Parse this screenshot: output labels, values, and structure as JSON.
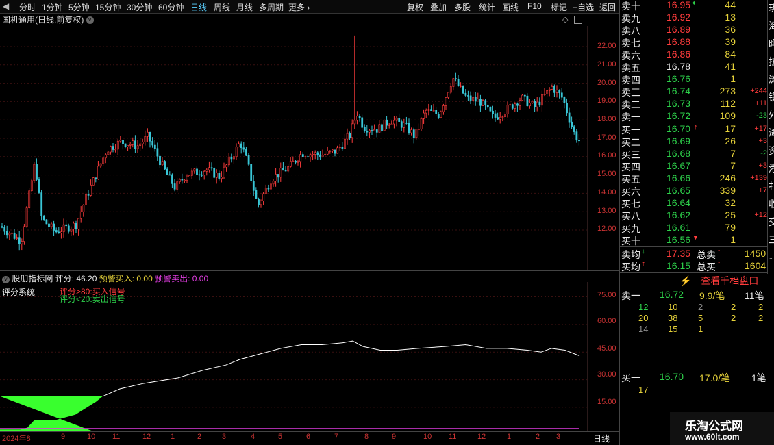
{
  "toolbar": {
    "periods": [
      "分时",
      "1分钟",
      "5分钟",
      "15分钟",
      "30分钟",
      "60分钟",
      "日线",
      "周线",
      "月线",
      "多周期",
      "更多"
    ],
    "active_period": "日线",
    "right_buttons": [
      "复权",
      "叠加",
      "多股",
      "统计",
      "画线",
      "F10",
      "标记",
      "+自选",
      "返回"
    ]
  },
  "chart_title": "国机通用(日线,前复权)",
  "price_axis": [
    "22.00",
    "21.00",
    "20.00",
    "19.00",
    "18.00",
    "17.00",
    "16.00",
    "15.00",
    "14.00",
    "13.00",
    "12.00"
  ],
  "indicator": {
    "name": "股朋指标网",
    "score_label": "评分: 46.20",
    "buy_alert": "预警买入: 0.00",
    "sell_alert": "预警卖出: 0.00",
    "system_label": "评分系统",
    "note_buy": "评分>80:买入信号",
    "note_sell": "评分<20:卖出信号",
    "axis": [
      "75.00",
      "60.00",
      "45.00",
      "30.00",
      "15.00"
    ]
  },
  "x_axis_labels": [
    "2024年8",
    "9",
    "10",
    "11",
    "12",
    "1",
    "2",
    "3",
    "4",
    "5",
    "6",
    "7",
    "8",
    "9",
    "10",
    "11",
    "12",
    "1",
    "2",
    "3"
  ],
  "x_axis_period": "日线",
  "orderbook": {
    "asks": [
      {
        "label": "卖十",
        "price": "16.95",
        "vol": "44",
        "chg": ""
      },
      {
        "label": "卖九",
        "price": "16.92",
        "vol": "13",
        "chg": ""
      },
      {
        "label": "卖八",
        "price": "16.89",
        "vol": "36",
        "chg": ""
      },
      {
        "label": "卖七",
        "price": "16.88",
        "vol": "39",
        "chg": ""
      },
      {
        "label": "卖六",
        "price": "16.86",
        "vol": "84",
        "chg": ""
      },
      {
        "label": "卖五",
        "price": "16.78",
        "vol": "41",
        "chg": ""
      },
      {
        "label": "卖四",
        "price": "16.76",
        "vol": "1",
        "chg": ""
      },
      {
        "label": "卖三",
        "price": "16.74",
        "vol": "273",
        "chg": "+244"
      },
      {
        "label": "卖二",
        "price": "16.73",
        "vol": "112",
        "chg": "+11"
      },
      {
        "label": "卖一",
        "price": "16.72",
        "vol": "109",
        "chg": "-23"
      }
    ],
    "bids": [
      {
        "label": "买一",
        "price": "16.70",
        "vol": "17",
        "chg": "+17"
      },
      {
        "label": "买二",
        "price": "16.69",
        "vol": "26",
        "chg": "+3"
      },
      {
        "label": "买三",
        "price": "16.68",
        "vol": "7",
        "chg": "-2"
      },
      {
        "label": "买四",
        "price": "16.67",
        "vol": "7",
        "chg": "+3"
      },
      {
        "label": "买五",
        "price": "16.66",
        "vol": "246",
        "chg": "+139"
      },
      {
        "label": "买六",
        "price": "16.65",
        "vol": "339",
        "chg": "+7"
      },
      {
        "label": "买七",
        "price": "16.64",
        "vol": "32",
        "chg": ""
      },
      {
        "label": "买八",
        "price": "16.62",
        "vol": "25",
        "chg": "+12"
      },
      {
        "label": "买九",
        "price": "16.61",
        "vol": "79",
        "chg": ""
      },
      {
        "label": "买十",
        "price": "16.56",
        "vol": "1",
        "chg": ""
      }
    ],
    "avg_sell_label": "卖均",
    "avg_sell": "17.35",
    "total_sell_label": "总卖",
    "total_sell": "1450",
    "avg_buy_label": "买均",
    "avg_buy": "16.15",
    "total_buy_label": "总买",
    "total_buy": "1604"
  },
  "queue": {
    "button": "查看千档盘口",
    "sell1": {
      "label": "卖一",
      "price": "16.72",
      "per": "9.9/笔",
      "count": "11笔"
    },
    "sell_rows": [
      [
        "12",
        "10",
        "2",
        "2",
        "2"
      ],
      [
        "20",
        "38",
        "5",
        "2",
        "2"
      ],
      [
        "14",
        "15",
        "1",
        "",
        ""
      ]
    ],
    "buy1": {
      "label": "买一",
      "price": "16.70",
      "per": "17.0/笔",
      "count": "1笔"
    },
    "buy_rows": [
      [
        "17"
      ]
    ]
  },
  "side_text": [
    "玥",
    "海",
    "晔",
    "拉",
    "浏",
    "锐",
    "外",
    "湾",
    "资",
    "港",
    "扑",
    "收",
    "交",
    "三",
    "↓"
  ],
  "watermark": {
    "line1": "乐淘公式网",
    "line2": "www.60lt.com"
  }
}
